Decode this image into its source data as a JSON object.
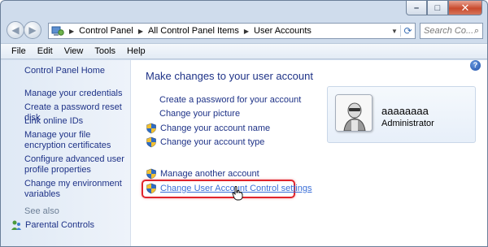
{
  "window": {
    "caption_buttons": {
      "minimize": "–",
      "maximize": "□",
      "close": "✕"
    }
  },
  "navigation": {
    "back_icon": "arrow-left-icon",
    "forward_icon": "arrow-right-icon",
    "breadcrumbs": [
      "Control Panel",
      "All Control Panel Items",
      "User Accounts"
    ],
    "search_placeholder": "Search Co..."
  },
  "menu": [
    "File",
    "Edit",
    "View",
    "Tools",
    "Help"
  ],
  "left_pane": {
    "home": "Control Panel Home",
    "links": [
      "Manage your credentials",
      "Create a password reset disk",
      "Link online IDs",
      "Manage your file encryption certificates",
      "Configure advanced user profile properties",
      "Change my environment variables"
    ],
    "see_also": "See also",
    "parental_controls": "Parental Controls"
  },
  "main": {
    "title": "Make changes to your user account",
    "tasks": [
      {
        "label": "Create a password for your account",
        "shield": false
      },
      {
        "label": "Change your picture",
        "shield": false
      },
      {
        "label": "Change your account name",
        "shield": true
      },
      {
        "label": "Change your account type",
        "shield": true
      }
    ],
    "other_tasks": [
      {
        "label": "Manage another account",
        "shield": true
      },
      {
        "label": "Change User Account Control settings",
        "shield": true,
        "highlighted": true
      }
    ]
  },
  "account": {
    "name": "aaaaaaaa",
    "role": "Administrator"
  },
  "colors": {
    "link": "#1e3287",
    "hover_link": "#3a6fd8",
    "highlight_box": "#e0242c",
    "left_pane_bg": "#dfe9f5"
  }
}
